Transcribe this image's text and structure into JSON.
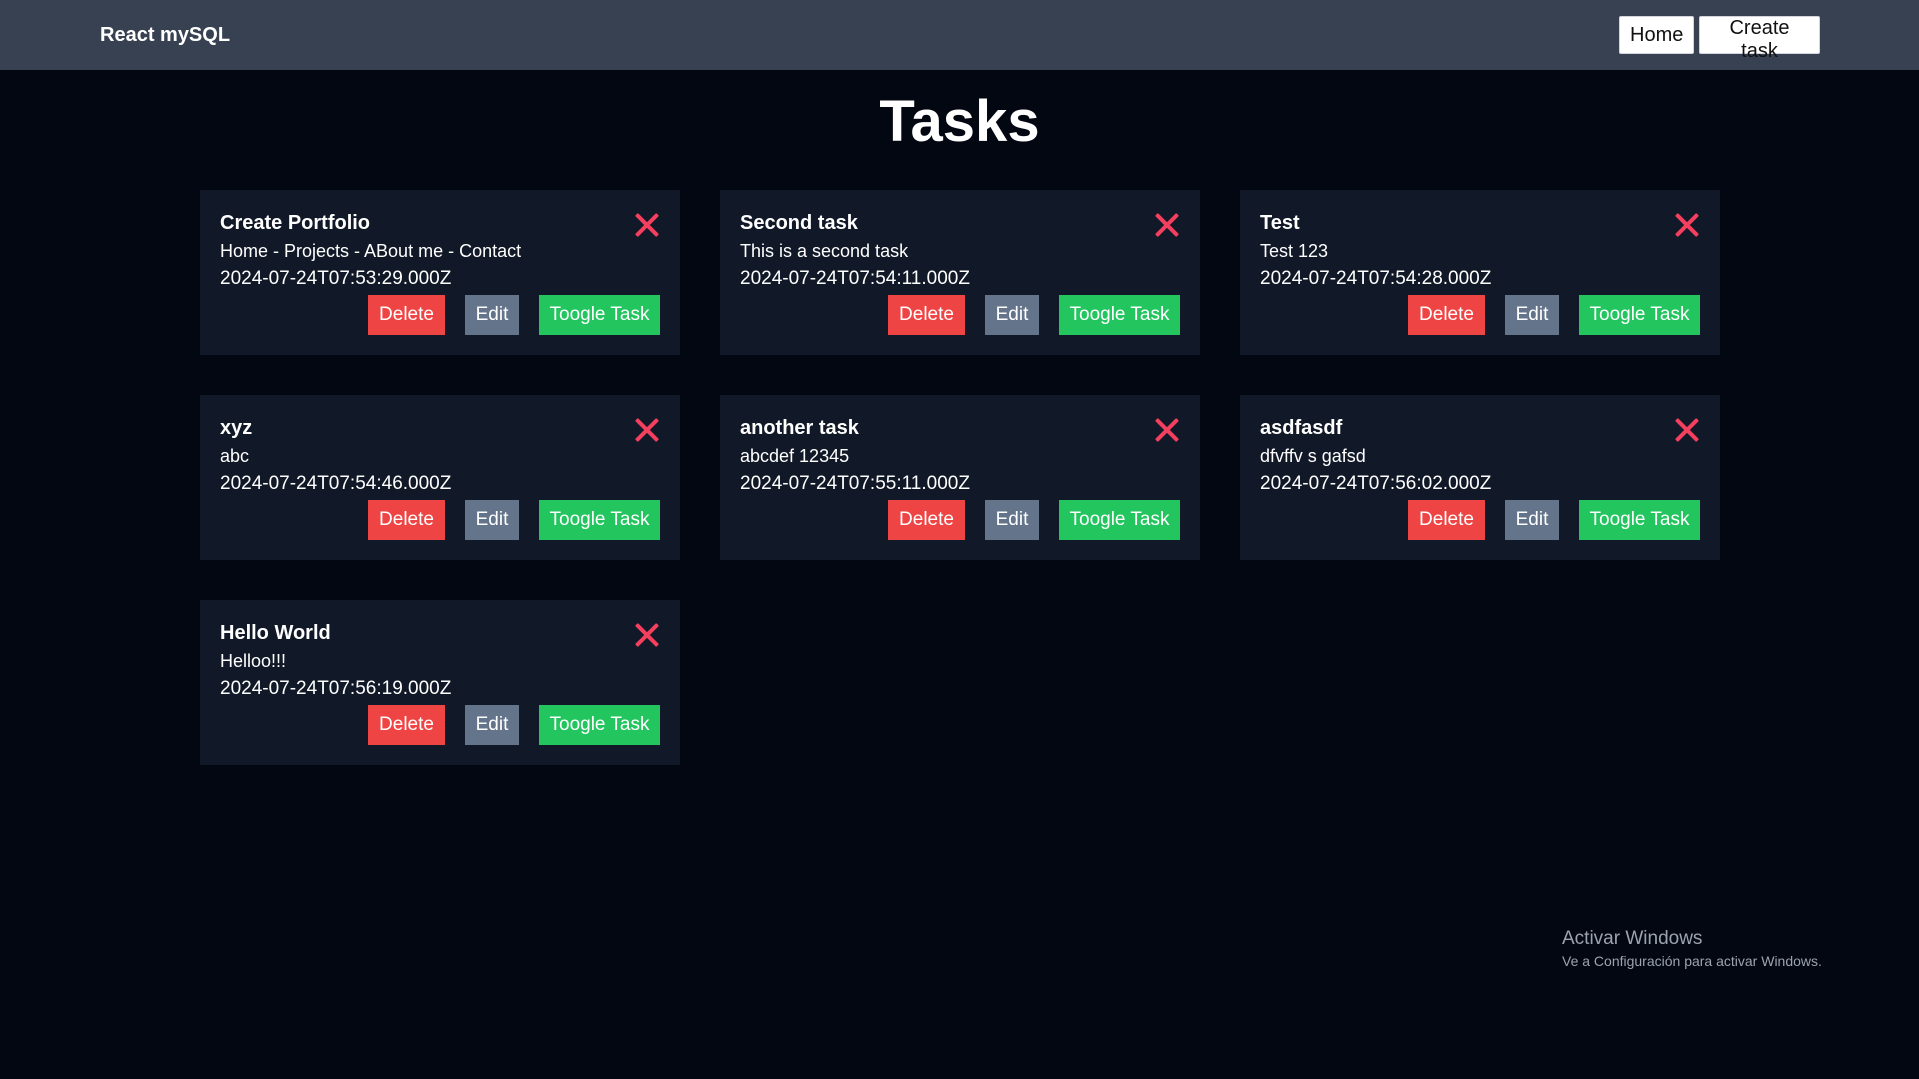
{
  "navbar": {
    "brand": "React mySQL",
    "home_label": "Home",
    "create_label": "Create task"
  },
  "page": {
    "title": "Tasks"
  },
  "buttons": {
    "delete": "Delete",
    "edit": "Edit",
    "toggle": "Toogle Task"
  },
  "tasks": [
    {
      "title": "Create Portfolio",
      "description": "Home - Projects - ABout me - Contact",
      "created": "2024-07-24T07:53:29.000Z"
    },
    {
      "title": "Second task",
      "description": "This is a second task",
      "created": "2024-07-24T07:54:11.000Z"
    },
    {
      "title": "Test",
      "description": "Test 123",
      "created": "2024-07-24T07:54:28.000Z"
    },
    {
      "title": "xyz",
      "description": "abc",
      "created": "2024-07-24T07:54:46.000Z"
    },
    {
      "title": "another task",
      "description": "abcdef 12345",
      "created": "2024-07-24T07:55:11.000Z"
    },
    {
      "title": "asdfasdf",
      "description": "dfvffv s gafsd",
      "created": "2024-07-24T07:56:02.000Z"
    },
    {
      "title": "Hello World",
      "description": "Helloo!!!",
      "created": "2024-07-24T07:56:19.000Z"
    }
  ],
  "watermark": {
    "title": "Activar Windows",
    "subtitle": "Ve a Configuración para activar Windows."
  },
  "colors": {
    "background": "#030712",
    "navbar": "#374151",
    "card": "#111827",
    "delete": "#ef4444",
    "edit": "#64748b",
    "toggle": "#22c55e",
    "close_icon": "#f43f5e"
  }
}
